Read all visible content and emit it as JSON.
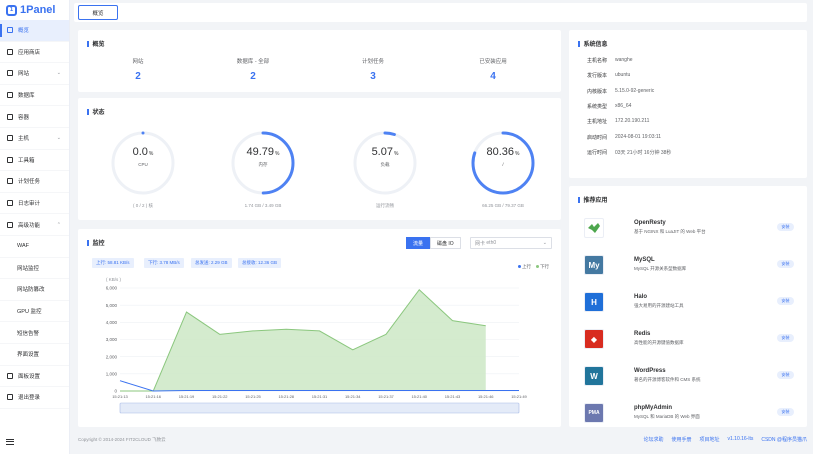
{
  "app": {
    "logo": "1Panel",
    "logo_mark": "1"
  },
  "sidebar": {
    "items": [
      {
        "label": "概览",
        "active": true
      },
      {
        "label": "应用商店"
      },
      {
        "label": "网站",
        "chevron": true
      },
      {
        "label": "数据库"
      },
      {
        "label": "容器"
      },
      {
        "label": "主机",
        "chevron": true
      },
      {
        "label": "工具箱"
      },
      {
        "label": "计划任务"
      },
      {
        "label": "日志审计"
      },
      {
        "label": "高级功能",
        "chevron": true,
        "expanded": true
      },
      {
        "label": "WAF",
        "sub": true
      },
      {
        "label": "网站监控",
        "sub": true
      },
      {
        "label": "网站防篡改",
        "sub": true
      },
      {
        "label": "GPU 监控",
        "sub": true
      },
      {
        "label": "短信告警",
        "sub": true
      },
      {
        "label": "界面设置",
        "sub": true
      },
      {
        "label": "面板设置"
      },
      {
        "label": "退出登录"
      }
    ]
  },
  "topbar": {
    "tab": "概览"
  },
  "overview": {
    "title": "概览",
    "items": [
      {
        "label": "网站",
        "value": "2"
      },
      {
        "label": "数据库 - 全部",
        "value": "2"
      },
      {
        "label": "计划任务",
        "value": "3"
      },
      {
        "label": "已安装应用",
        "value": "4"
      }
    ]
  },
  "status": {
    "title": "状态",
    "gauges": [
      {
        "value": "0.0",
        "unit": "%",
        "label": "CPU",
        "sub": "( 0 / 2 ) 核",
        "pct": 0.0
      },
      {
        "value": "49.79",
        "unit": "%",
        "label": "内存",
        "sub": "1.74 GB / 3.49 GB",
        "pct": 49.79
      },
      {
        "value": "5.07",
        "unit": "%",
        "label": "负载",
        "sub": "运行流畅",
        "pct": 5.07
      },
      {
        "value": "80.36",
        "unit": "%",
        "label": "/",
        "sub": "66.25 GB / 79.37 GB",
        "pct": 80.36
      }
    ]
  },
  "monitor": {
    "title": "监控",
    "toggle": [
      "流量",
      "磁盘 IO"
    ],
    "select_label": "网卡",
    "select_value": "eth0",
    "chips": [
      "上行: 58.81 KB/s",
      "下行: 3.78 MB/s",
      "总发送: 2.29 GB",
      "总接收: 12.36 GB"
    ],
    "legend": [
      "上行",
      "下行"
    ],
    "colors": {
      "up": "#3a72f0",
      "down": "#8bc77e"
    }
  },
  "chart_data": {
    "type": "area",
    "ylabel": "( KB/s )",
    "ylim": [
      0,
      6000
    ],
    "yticks": [
      0,
      1000,
      2000,
      3000,
      4000,
      5000,
      6000
    ],
    "ytick_labels": [
      "0",
      "1,000",
      "2,000",
      "3,000",
      "4,000",
      "5,000",
      "6,000"
    ],
    "x": [
      "15:21:13",
      "15:21:16",
      "15:21:19",
      "15:21:22",
      "15:21:25",
      "15:21:28",
      "15:21:31",
      "15:21:34",
      "15:21:37",
      "15:21:40",
      "15:21:43",
      "15:21:46",
      "15:21:49"
    ],
    "series": [
      {
        "name": "上行",
        "values": [
          600,
          0,
          30,
          30,
          30,
          30,
          30,
          30,
          30,
          30,
          30,
          30,
          30
        ]
      },
      {
        "name": "下行",
        "values": [
          0,
          0,
          4600,
          3300,
          3500,
          3600,
          3500,
          2400,
          3300,
          5900,
          4100,
          3800,
          null
        ]
      }
    ]
  },
  "sysinfo": {
    "title": "系统信息",
    "rows": [
      {
        "k": "主机名称",
        "v": "wanghe"
      },
      {
        "k": "发行版本",
        "v": "ubuntu"
      },
      {
        "k": "内核版本",
        "v": "5.15.0-92-generic"
      },
      {
        "k": "系统类型",
        "v": "x86_64"
      },
      {
        "k": "主机地址",
        "v": "172.20.190.211"
      },
      {
        "k": "启动时间",
        "v": "2024-08-01 19:03:11"
      },
      {
        "k": "运行时间",
        "v": "03天 21小时 16分钟 38秒"
      }
    ]
  },
  "apps": {
    "title": "推荐应用",
    "items": [
      {
        "name": "OpenResty",
        "desc": "基于 NGINX 和 LuaJIT 的 Web 平台",
        "btn": "安装",
        "icon": "openresty-icon",
        "color": "#ffffff",
        "glyph": ""
      },
      {
        "name": "MySQL",
        "desc": "MySQL 开源关系型数据库",
        "btn": "安装",
        "icon": "mysql-icon",
        "color": "#4479a1",
        "glyph": "My"
      },
      {
        "name": "Halo",
        "desc": "强大易用的开源建站工具",
        "btn": "安装",
        "icon": "halo-icon",
        "color": "#1f6fd8",
        "glyph": "H"
      },
      {
        "name": "Redis",
        "desc": "高性能的开源键值数据库",
        "btn": "安装",
        "icon": "redis-icon",
        "color": "#d82c20",
        "glyph": "◆"
      },
      {
        "name": "WordPress",
        "desc": "著名的开源博客软件和 CMS 系统",
        "btn": "安装",
        "icon": "wordpress-icon",
        "color": "#21759b",
        "glyph": "W"
      },
      {
        "name": "phpMyAdmin",
        "desc": "MySQL 和 MariaDB 的 Web 界面",
        "btn": "安装",
        "icon": "phpmyadmin-icon",
        "color": "#6c78af",
        "glyph": "PMA"
      }
    ]
  },
  "footer": {
    "copyright": "Copyright © 2014-2024 FIT2CLOUD 飞致云",
    "links": [
      "论坛求助",
      "使用手册",
      "项目地址",
      "v1.10.16-lts",
      "CSDN @程序员猫爪"
    ]
  }
}
